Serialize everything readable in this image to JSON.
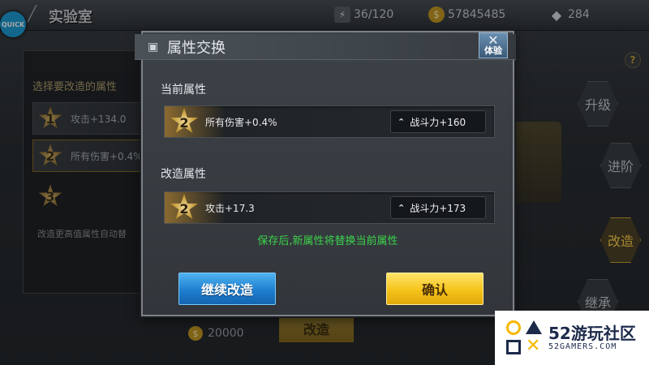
{
  "background": {
    "quick_label": "QUICK",
    "screen_title": "实验室",
    "resources": {
      "energy": "36/120",
      "coins": "57845485",
      "gems": "284"
    },
    "left_panel": {
      "header": "选择要改造的属性",
      "rows": [
        {
          "star": "1",
          "text": "攻击+134.0"
        },
        {
          "star": "2",
          "text": "所有伤害+0.4%"
        },
        {
          "star": "3",
          "text": ""
        }
      ],
      "note": "改造更高值属性自动替"
    },
    "cost": "20000",
    "modify_button": "改造",
    "side_buttons": {
      "upgrade": "升级",
      "advance": "进阶",
      "modify": "改造",
      "inherit": "继承"
    },
    "help": "?"
  },
  "dialog": {
    "title": "属性交换",
    "close_tag": "体验",
    "current_label": "当前属性",
    "current": {
      "star": "2",
      "attr": "所有伤害+0.4%",
      "power": "战斗力+160"
    },
    "modified_label": "改造属性",
    "modified": {
      "star": "2",
      "attr": "攻击+17.3",
      "power": "战斗力+173"
    },
    "notice": "保存后,新属性将替换当前属性",
    "continue_label": "继续改造",
    "confirm_label": "确认"
  },
  "watermark": {
    "main": "52游玩社区",
    "sub": "52GAMERS.COM"
  },
  "colors": {
    "notice_green": "#3cd24a",
    "continue_blue": "#1e7fd0",
    "confirm_yellow": "#f5c31a",
    "gold_star": "#c49a3a"
  },
  "icons": [
    "back-icon",
    "energy-icon",
    "coin-icon",
    "gem-icon",
    "cube-icon",
    "close-icon",
    "star-badge-icon",
    "power-up-icon",
    "help-icon"
  ]
}
